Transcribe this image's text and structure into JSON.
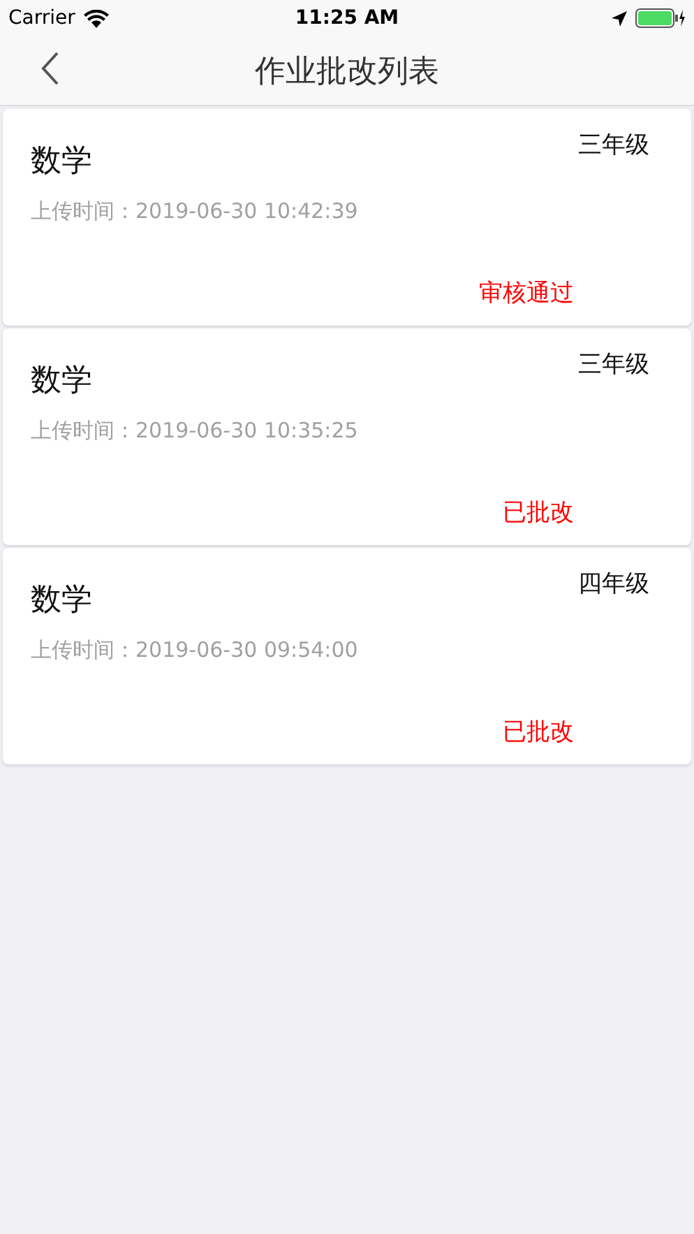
{
  "status_bar": {
    "carrier": "Carrier",
    "time": "11:25 AM"
  },
  "nav": {
    "title": "作业批改列表"
  },
  "items": [
    {
      "subject": "数学",
      "grade": "三年级",
      "upload_time": "上传时间：2019-06-30 10:42:39",
      "status": "审核通过"
    },
    {
      "subject": "数学",
      "grade": "三年级",
      "upload_time": "上传时间：2019-06-30 10:35:25",
      "status": "已批改"
    },
    {
      "subject": "数学",
      "grade": "四年级",
      "upload_time": "上传时间：2019-06-30 09:54:00",
      "status": "已批改"
    }
  ]
}
